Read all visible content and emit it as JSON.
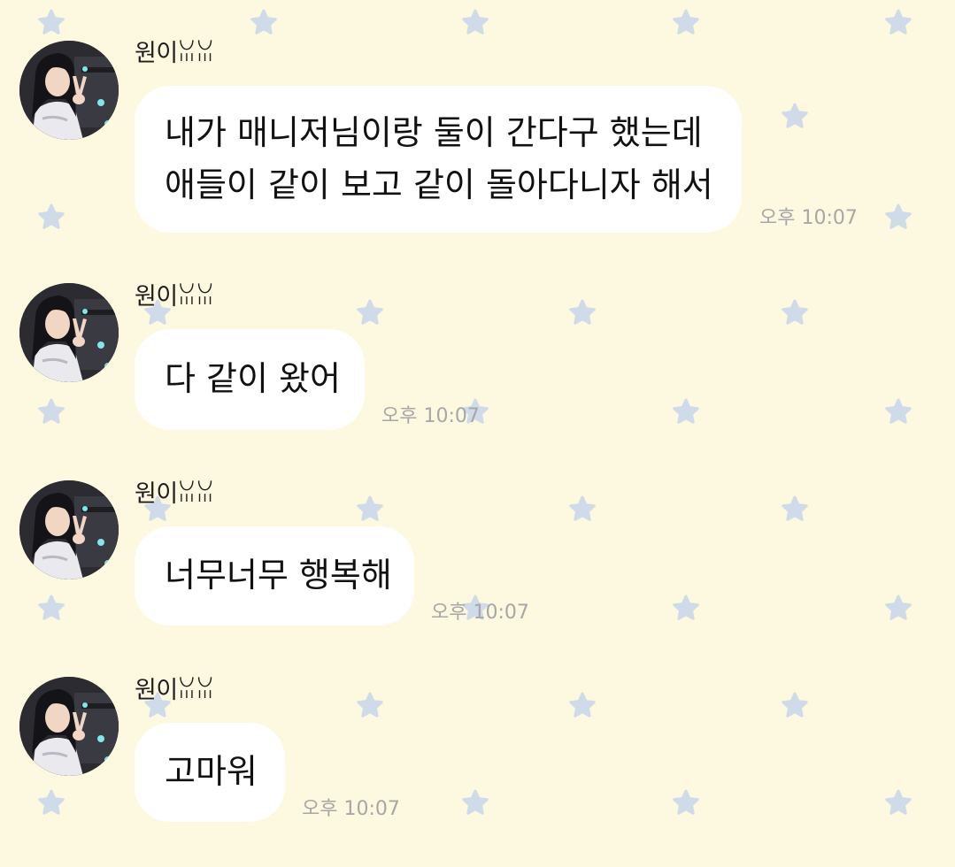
{
  "colors": {
    "background": "#fdf8e0",
    "star": "#cfdbe8",
    "bubble": "#ffffff",
    "timestamp": "#a7a7a7"
  },
  "messages": [
    {
      "sender": "원이ꈍꈍ",
      "lines": [
        "내가 매니저님이랑 둘이 간다구 했는데",
        "애들이 같이 보고 같이 돌아다니자 해서"
      ],
      "time": "오후 10:07"
    },
    {
      "sender": "원이ꈍꈍ",
      "lines": [
        "다 같이 왔어"
      ],
      "time": "오후 10:07"
    },
    {
      "sender": "원이ꈍꈍ",
      "lines": [
        "너무너무 행복해"
      ],
      "time": "오후 10:07"
    },
    {
      "sender": "원이ꈍꈍ",
      "lines": [
        "고마워"
      ],
      "time": "오후 10:07"
    }
  ]
}
